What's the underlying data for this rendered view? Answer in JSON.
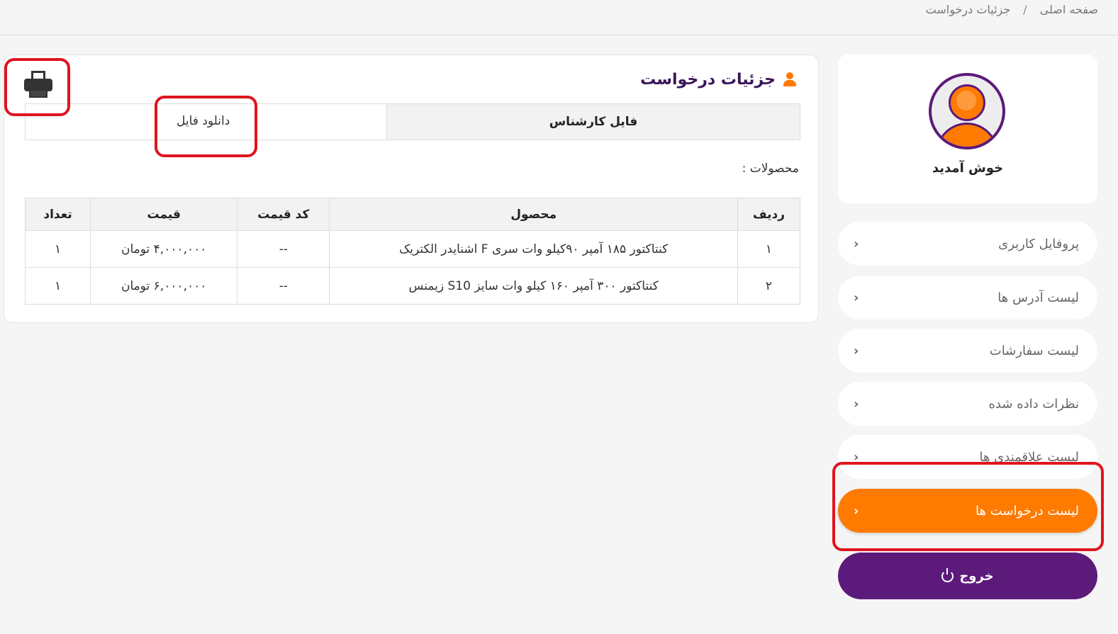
{
  "breadcrumb": {
    "home": "صفحه اصلی",
    "separator": "/",
    "current": "جزئیات درخواست"
  },
  "profile": {
    "welcome": "خوش آمدید"
  },
  "sidebar": {
    "items": [
      {
        "label": "پروفایل کاربری",
        "active": false
      },
      {
        "label": "لیست آدرس ها",
        "active": false
      },
      {
        "label": "لیست سفارشات",
        "active": false
      },
      {
        "label": "نظرات داده شده",
        "active": false
      },
      {
        "label": "لیست علاقمندی ها",
        "active": false
      },
      {
        "label": "لیست درخواست ها",
        "active": true
      }
    ],
    "logout": "خروج"
  },
  "main": {
    "title": "جزئیات درخواست",
    "file": {
      "label": "فایل کارشناس",
      "link": "دانلود فایل"
    },
    "products_label": "محصولات :",
    "table": {
      "headers": [
        "ردیف",
        "محصول",
        "کد قیمت",
        "قیمت",
        "تعداد"
      ],
      "rows": [
        [
          "۱",
          "کنتاکتور ۱۸۵ آمپر ۹۰کیلو وات سری F اشنایدر الکتریک",
          "--",
          "۴,۰۰۰,۰۰۰ تومان",
          "۱"
        ],
        [
          "۲",
          "کنتاکتور ۳۰۰ آمپر ۱۶۰ کیلو وات سایز S10 زیمنس",
          "--",
          "۶,۰۰۰,۰۰۰ تومان",
          "۱"
        ]
      ]
    }
  },
  "colors": {
    "accent": "#ff7a00",
    "brand_purple": "#5c1a7a",
    "highlight": "#e0141e"
  }
}
